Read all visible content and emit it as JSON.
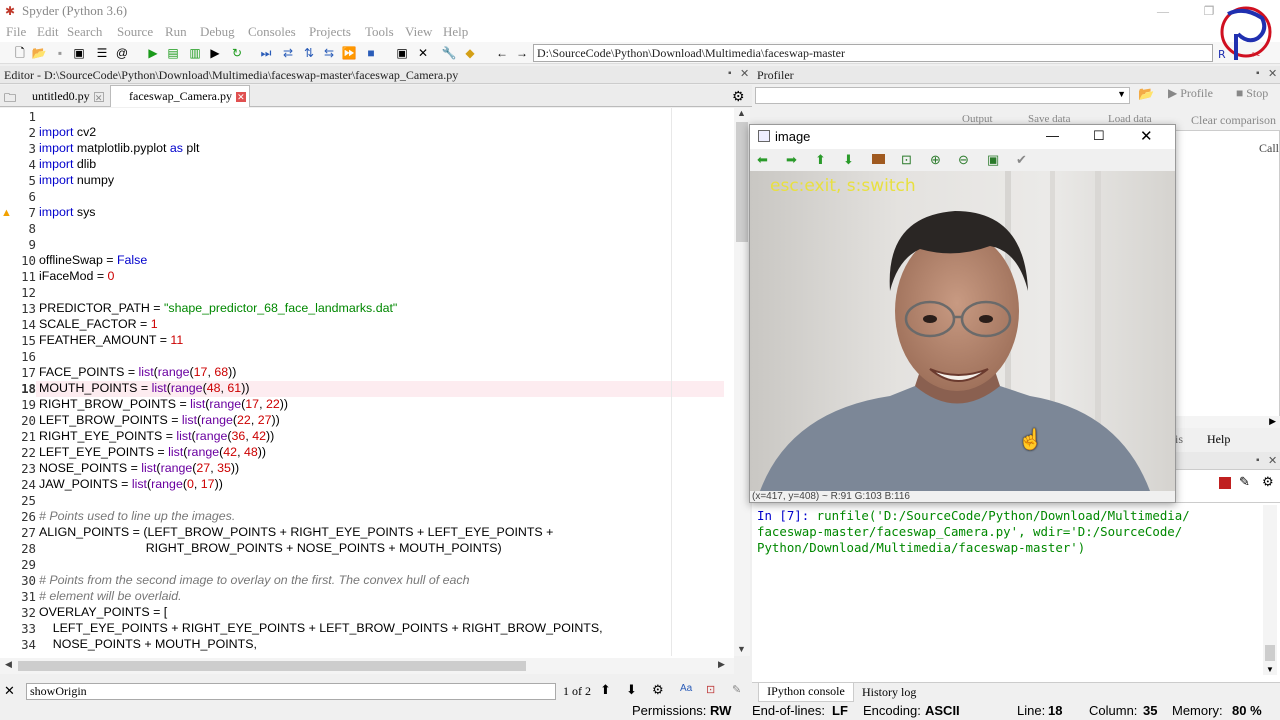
{
  "window": {
    "title": "Spyder (Python 3.6)"
  },
  "menu": [
    "File",
    "Edit",
    "Search",
    "Source",
    "Run",
    "Debug",
    "Consoles",
    "Projects",
    "Tools",
    "View",
    "Help"
  ],
  "path": "D:\\SourceCode\\Python\\Download\\Multimedia\\faceswap-master",
  "editor": {
    "title": "Editor - D:\\SourceCode\\Python\\Download\\Multimedia\\faceswap-master\\faceswap_Camera.py",
    "tabs": [
      {
        "label": "untitled0.py"
      },
      {
        "label": "faceswap_Camera.py"
      }
    ],
    "current_line": 18,
    "lines": [
      "",
      "import cv2",
      "import matplotlib.pyplot as plt",
      "import dlib",
      "import numpy",
      "",
      "import sys",
      "",
      "",
      "offlineSwap = False",
      "iFaceMod = 0",
      "",
      "PREDICTOR_PATH = \"shape_predictor_68_face_landmarks.dat\"",
      "SCALE_FACTOR = 1",
      "FEATHER_AMOUNT = 11",
      "",
      "FACE_POINTS = list(range(17, 68))",
      "MOUTH_POINTS = list(range(48, 61))",
      "RIGHT_BROW_POINTS = list(range(17, 22))",
      "LEFT_BROW_POINTS = list(range(22, 27))",
      "RIGHT_EYE_POINTS = list(range(36, 42))",
      "LEFT_EYE_POINTS = list(range(42, 48))",
      "NOSE_POINTS = list(range(27, 35))",
      "JAW_POINTS = list(range(0, 17))",
      "",
      "# Points used to line up the images.",
      "ALIGN_POINTS = (LEFT_BROW_POINTS + RIGHT_EYE_POINTS + LEFT_EYE_POINTS +",
      "                               RIGHT_BROW_POINTS + NOSE_POINTS + MOUTH_POINTS)",
      "",
      "# Points from the second image to overlay on the first. The convex hull of each",
      "# element will be overlaid.",
      "OVERLAY_POINTS = [",
      "    LEFT_EYE_POINTS + RIGHT_EYE_POINTS + LEFT_BROW_POINTS + RIGHT_BROW_POINTS,",
      "    NOSE_POINTS + MOUTH_POINTS,"
    ]
  },
  "find": {
    "value": "showOrigin",
    "count": "1 of 2"
  },
  "profiler": {
    "title": "Profiler",
    "profile_label": "Profile",
    "stop_label": "Stop",
    "output_label": "Output",
    "save_label": "Save data",
    "load_label": "Load data",
    "clear_label": "Clear comparison",
    "call_label": "Call",
    "tab_help": "Help",
    "tab_partial": "is"
  },
  "image_window": {
    "title": "image",
    "overlay_text": "esc:exit, s:switch",
    "status": "(x=417, y=408) ~ R:91 G:103 B:116"
  },
  "console": {
    "prompt": "In [7]:",
    "text": " runfile('D:/SourceCode/Python/Download/Multimedia/\nfaceswap-master/faceswap_Camera.py', wdir='D:/SourceCode/\nPython/Download/Multimedia/faceswap-master')"
  },
  "bottom_tabs": {
    "ipython": "IPython console",
    "history": "History log"
  },
  "status": {
    "permissions_label": "Permissions:",
    "permissions": "RW",
    "eol_label": "End-of-lines:",
    "eol": "LF",
    "encoding_label": "Encoding:",
    "encoding": "ASCII",
    "line_label": "Line:",
    "line": "18",
    "column_label": "Column:",
    "column": "35",
    "memory_label": "Memory:",
    "memory": "80 %"
  }
}
